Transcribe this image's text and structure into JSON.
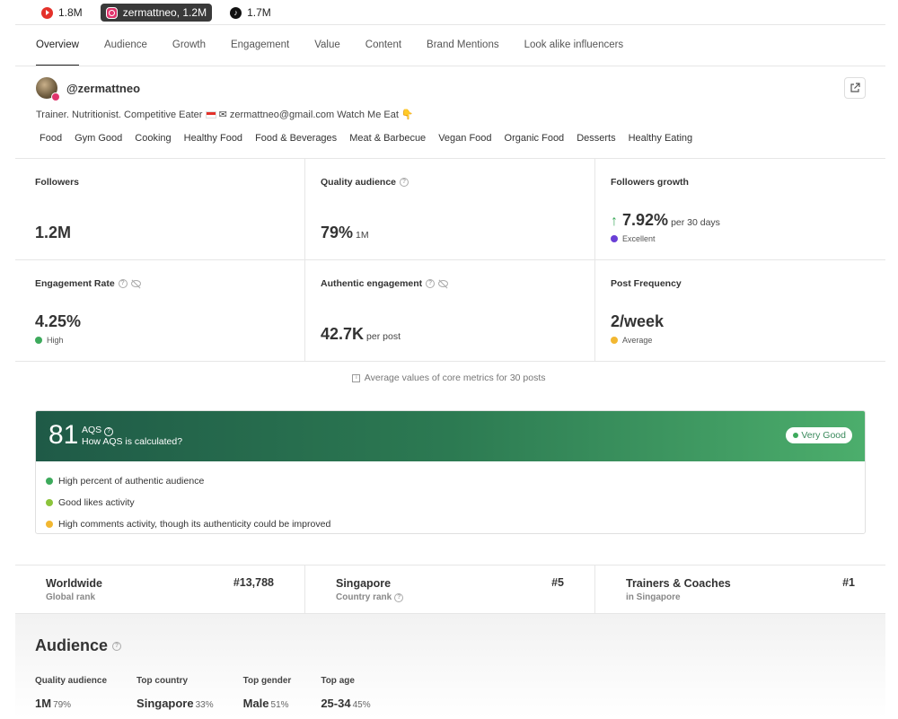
{
  "platforms": [
    {
      "label": "1.8M",
      "icon": "youtube-icon"
    },
    {
      "label": "zermattneo,  1.2M",
      "icon": "instagram-icon"
    },
    {
      "label": "1.7M",
      "icon": "tiktok-icon"
    }
  ],
  "tabs": [
    "Overview",
    "Audience",
    "Growth",
    "Engagement",
    "Value",
    "Content",
    "Brand Mentions",
    "Look alike influencers"
  ],
  "profile": {
    "handle": "@zermattneo",
    "bio_part1": "Trainer. Nutritionist. Competitive Eater",
    "bio_part2": "✉ zermattneo@gmail.com Watch Me Eat 👇"
  },
  "tags": [
    "Food",
    "Gym Good",
    "Cooking",
    "Healthy Food",
    "Food & Beverages",
    "Meat & Barbecue",
    "Vegan Food",
    "Organic Food",
    "Desserts",
    "Healthy Eating"
  ],
  "metrics": {
    "followers": {
      "label": "Followers",
      "value": "1.2M"
    },
    "quality_audience": {
      "label": "Quality audience",
      "value": "79%",
      "sub": "1M"
    },
    "followers_growth": {
      "label": "Followers growth",
      "value": "7.92%",
      "sub": "per 30 days",
      "status": "Excellent"
    },
    "engagement_rate": {
      "label": "Engagement Rate",
      "value": "4.25%",
      "status": "High"
    },
    "authentic_engagement": {
      "label": "Authentic engagement",
      "value": "42.7K",
      "sub": "per post"
    },
    "post_frequency": {
      "label": "Post Frequency",
      "value": "2/week",
      "status": "Average"
    }
  },
  "avg_note": "Average values of core metrics for 30 posts",
  "aqs": {
    "score": "81",
    "label": "AQS",
    "how": "How AQS is calculated?",
    "badge": "Very Good",
    "items": [
      {
        "text": "High percent of authentic audience",
        "color": "#3daa5c"
      },
      {
        "text": "Good likes activity",
        "color": "#8cc43c"
      },
      {
        "text": "High comments activity, though its authenticity could be improved",
        "color": "#f2b731"
      }
    ]
  },
  "ranks": [
    {
      "title": "Worldwide",
      "sub": "Global rank",
      "num": "#13,788"
    },
    {
      "title": "Singapore",
      "sub": "Country rank",
      "num": "#5"
    },
    {
      "title": "Trainers & Coaches",
      "sub": "in Singapore",
      "num": "#1"
    }
  ],
  "audience": {
    "title": "Audience",
    "cols": [
      {
        "label": "Quality audience",
        "value": "1M",
        "pct": "79%"
      },
      {
        "label": "Top country",
        "value": "Singapore",
        "pct": "33%"
      },
      {
        "label": "Top gender",
        "value": "Male",
        "pct": "51%"
      },
      {
        "label": "Top age",
        "value": "25-34",
        "pct": "45%"
      }
    ]
  },
  "colors": {
    "excellent": "#6a3fd6",
    "high": "#3daa5c",
    "average": "#f2b731",
    "growth_arrow": "#3daa5c"
  }
}
